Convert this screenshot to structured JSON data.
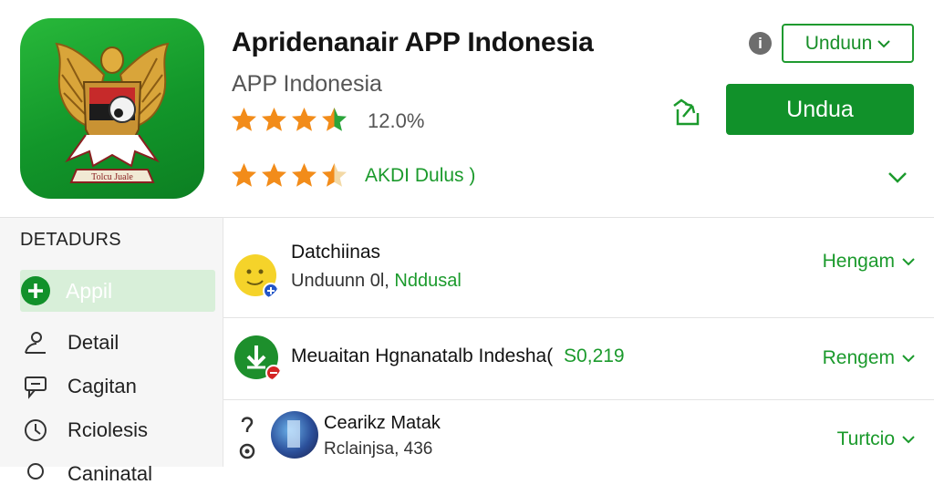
{
  "header": {
    "title": "Apridenanair APP Indonesia",
    "subtitle": "APP Indonesia",
    "rating_value": "12.0%",
    "age_label": "AKDI Dulus )",
    "dropdown_label": "Unduun",
    "install_label": "Undua",
    "info_icon": "i",
    "emblem_text": "Tolcu Juale"
  },
  "sidebar": {
    "heading": "DETADURS",
    "items": [
      {
        "label": "Appil",
        "icon": "plus-icon",
        "active": true
      },
      {
        "label": "Detail",
        "icon": "person-icon"
      },
      {
        "label": "Cagitan",
        "icon": "chat-icon"
      },
      {
        "label": "Rciolesis",
        "icon": "clock-icon"
      },
      {
        "label": "Caninatal",
        "icon": "location-icon"
      }
    ]
  },
  "rows": [
    {
      "title": "Datchiinas",
      "subtitle_plain": "Unduunn 0l, ",
      "subtitle_highlight": "Nddusal",
      "action": "Hengam",
      "icon": "face-avatar"
    },
    {
      "title": "Meuaitan Hgnanatalb Indesha(",
      "title_highlight": "S0,219",
      "action": "Rengem",
      "icon": "download-icon"
    },
    {
      "title": "Cearikz Matak",
      "subtitle_plain": "Rclainjsa, 436",
      "action": "Turtcio",
      "icon": "photo-avatar"
    }
  ],
  "colors": {
    "brand_green": "#11912a",
    "accent_green": "#1b9a2c",
    "star_orange": "#f28c1a",
    "sidebar_active": "#d8efd9"
  }
}
